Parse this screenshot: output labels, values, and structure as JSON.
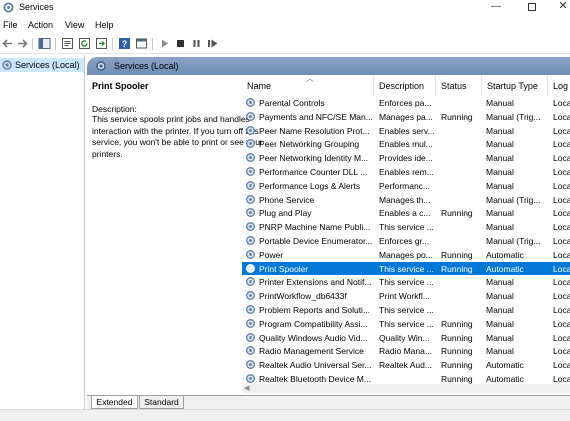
{
  "window": {
    "title": "Services"
  },
  "menu": [
    "File",
    "Action",
    "View",
    "Help"
  ],
  "tree": {
    "item_label": "Services (Local)"
  },
  "panel": {
    "header_label": "Services (Local)",
    "selected_service": "Print Spooler",
    "description_label": "Description:",
    "description_text": "This service spools print jobs and handles interaction with the printer. If you turn off this service, you won't be able to print or see your printers."
  },
  "columns": [
    "Name",
    "Description",
    "Status",
    "Startup Type",
    "Log"
  ],
  "rows": [
    {
      "name": "Parental Controls",
      "desc": "Enforces pa...",
      "status": "",
      "startup": "Manual",
      "log": "Loca"
    },
    {
      "name": "Payments and NFC/SE Man...",
      "desc": "Manages pa...",
      "status": "Running",
      "startup": "Manual (Trig...",
      "log": "Loca"
    },
    {
      "name": "Peer Name Resolution Prot...",
      "desc": "Enables serv...",
      "status": "",
      "startup": "Manual",
      "log": "Loca"
    },
    {
      "name": "Peer Networking Grouping",
      "desc": "Enables mul...",
      "status": "",
      "startup": "Manual",
      "log": "Loca"
    },
    {
      "name": "Peer Networking Identity M...",
      "desc": "Provides ide...",
      "status": "",
      "startup": "Manual",
      "log": "Loca"
    },
    {
      "name": "Performance Counter DLL ...",
      "desc": "Enables rem...",
      "status": "",
      "startup": "Manual",
      "log": "Loca"
    },
    {
      "name": "Performance Logs & Alerts",
      "desc": "Performanc...",
      "status": "",
      "startup": "Manual",
      "log": "Loca"
    },
    {
      "name": "Phone Service",
      "desc": "Manages th...",
      "status": "",
      "startup": "Manual (Trig...",
      "log": "Loca"
    },
    {
      "name": "Plug and Play",
      "desc": "Enables a c...",
      "status": "Running",
      "startup": "Manual",
      "log": "Loca"
    },
    {
      "name": "PNRP Machine Name Publi...",
      "desc": "This service ...",
      "status": "",
      "startup": "Manual",
      "log": "Loca"
    },
    {
      "name": "Portable Device Enumerator...",
      "desc": "Enforces gr...",
      "status": "",
      "startup": "Manual (Trig...",
      "log": "Loca"
    },
    {
      "name": "Power",
      "desc": "Manages po...",
      "status": "Running",
      "startup": "Automatic",
      "log": "Loca"
    },
    {
      "name": "Print Spooler",
      "desc": "This service ...",
      "status": "Running",
      "startup": "Automatic",
      "log": "Loca"
    },
    {
      "name": "Printer Extensions and Notif...",
      "desc": "This service ...",
      "status": "",
      "startup": "Manual",
      "log": "Loca"
    },
    {
      "name": "PrintWorkflow_db6433f",
      "desc": "Print Workfl...",
      "status": "",
      "startup": "Manual",
      "log": "Loca"
    },
    {
      "name": "Problem Reports and Soluti...",
      "desc": "This service ...",
      "status": "",
      "startup": "Manual",
      "log": "Loca"
    },
    {
      "name": "Program Compatibility Assi...",
      "desc": "This service ...",
      "status": "Running",
      "startup": "Manual",
      "log": "Loca"
    },
    {
      "name": "Quality Windows Audio Vid...",
      "desc": "Quality Win...",
      "status": "Running",
      "startup": "Manual",
      "log": "Loca"
    },
    {
      "name": "Radio Management Service",
      "desc": "Radio Mana...",
      "status": "Running",
      "startup": "Manual",
      "log": "Loca"
    },
    {
      "name": "Realtek Audio Universal Ser...",
      "desc": "Realtek Aud...",
      "status": "Running",
      "startup": "Automatic",
      "log": "Loca"
    },
    {
      "name": "Realtek Bluetooth Device M...",
      "desc": "",
      "status": "Running",
      "startup": "Automatic",
      "log": "Loca"
    }
  ],
  "selected_index": 12,
  "tabs": [
    "Extended",
    "Standard"
  ],
  "colors": {
    "selection": "#0078d7",
    "tree_selection": "#cce8ff",
    "header_gradient": "#7f9abc"
  },
  "icons": [
    "services-app-icon",
    "back-arrow-icon",
    "forward-arrow-icon",
    "console-tree-icon",
    "properties-icon",
    "refresh-icon",
    "export-icon",
    "help-icon",
    "console-icon",
    "play-icon",
    "stop-icon",
    "pause-icon",
    "restart-icon",
    "gear-icon"
  ]
}
